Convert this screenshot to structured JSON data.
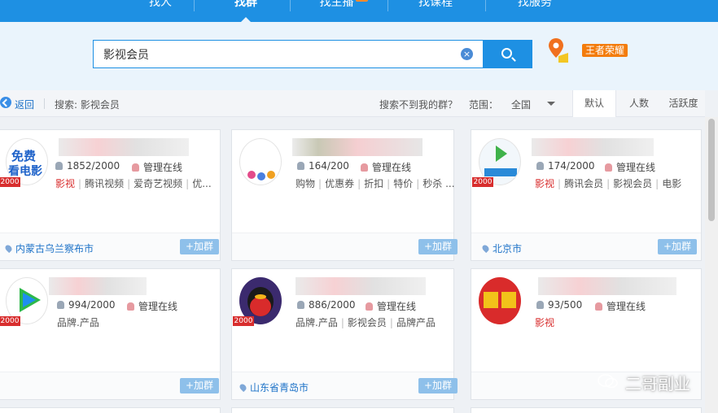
{
  "nav": {
    "tabs": [
      "找人",
      "找群",
      "找主播",
      "找课程",
      "找服务"
    ],
    "active": "找群"
  },
  "search": {
    "value": "影视会员",
    "game_badge": "王者荣耀"
  },
  "filter": {
    "back": "返回",
    "keyword_label": "搜索: 影视会员",
    "not_found": "搜索不到我的群？",
    "range_label": "范围：",
    "range_value": "全国",
    "sort": [
      "默认",
      "人数",
      "活跃度"
    ]
  },
  "cards": [
    {
      "members": "1852/2000",
      "admin": "管理在线",
      "level": "2000",
      "tags": [
        {
          "text": "影视",
          "red": true
        },
        {
          "text": "腾讯视频"
        },
        {
          "text": "爱奇艺视频"
        },
        {
          "text": "优..."
        }
      ],
      "location": "内蒙古乌兰察布市",
      "join": "+加群"
    },
    {
      "members": "164/200",
      "admin": "管理在线",
      "level": "",
      "tags": [
        {
          "text": "购物"
        },
        {
          "text": "优惠券"
        },
        {
          "text": "折扣"
        },
        {
          "text": "特价"
        },
        {
          "text": "秒杀 ..."
        }
      ],
      "location": "",
      "join": "+加群"
    },
    {
      "members": "174/2000",
      "admin": "管理在线",
      "level": "2000",
      "tags": [
        {
          "text": "影视",
          "red": true
        },
        {
          "text": "腾讯会员"
        },
        {
          "text": "影视会员"
        },
        {
          "text": "电影"
        }
      ],
      "location": "北京市",
      "join": "+加群"
    },
    {
      "members": "994/2000",
      "admin": "管理在线",
      "level": "2000",
      "tags": [
        {
          "text": "品牌.产品"
        }
      ],
      "location": "",
      "join": "+加群"
    },
    {
      "members": "886/2000",
      "admin": "管理在线",
      "level": "2000",
      "tags": [
        {
          "text": "品牌.产品"
        },
        {
          "text": "影视会员"
        },
        {
          "text": "品牌产品"
        }
      ],
      "location": "山东省青岛市",
      "join": "+加群"
    },
    {
      "members": "93/500",
      "admin": "管理在线",
      "level": "",
      "tags": [
        {
          "text": "影视",
          "red": true
        }
      ],
      "location": "",
      "join": ""
    }
  ],
  "watermark": "二哥副业"
}
